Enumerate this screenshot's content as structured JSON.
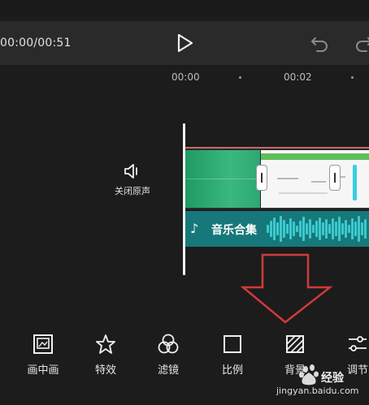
{
  "playback": {
    "time": "00:00/00:51"
  },
  "ruler": {
    "labels": [
      "00:00",
      "00:02"
    ]
  },
  "track_controls": {
    "mute_label": "关闭原声"
  },
  "audio": {
    "title": "音乐合集",
    "note_icon": "♪"
  },
  "toolbar": {
    "items": [
      {
        "label": "画中画",
        "icon": "picture-in-picture-icon"
      },
      {
        "label": "特效",
        "icon": "star-effect-icon"
      },
      {
        "label": "滤镜",
        "icon": "filter-icon"
      },
      {
        "label": "比例",
        "icon": "ratio-icon"
      },
      {
        "label": "背景",
        "icon": "background-icon"
      },
      {
        "label": "调节",
        "icon": "adjust-icon"
      }
    ]
  },
  "watermark": {
    "brand": "经验",
    "url": "jingyan.baidu.com"
  },
  "colors": {
    "accent_track_border": "#c96767",
    "audio_track": "#16787a",
    "annotation_arrow": "#d23a3a"
  }
}
